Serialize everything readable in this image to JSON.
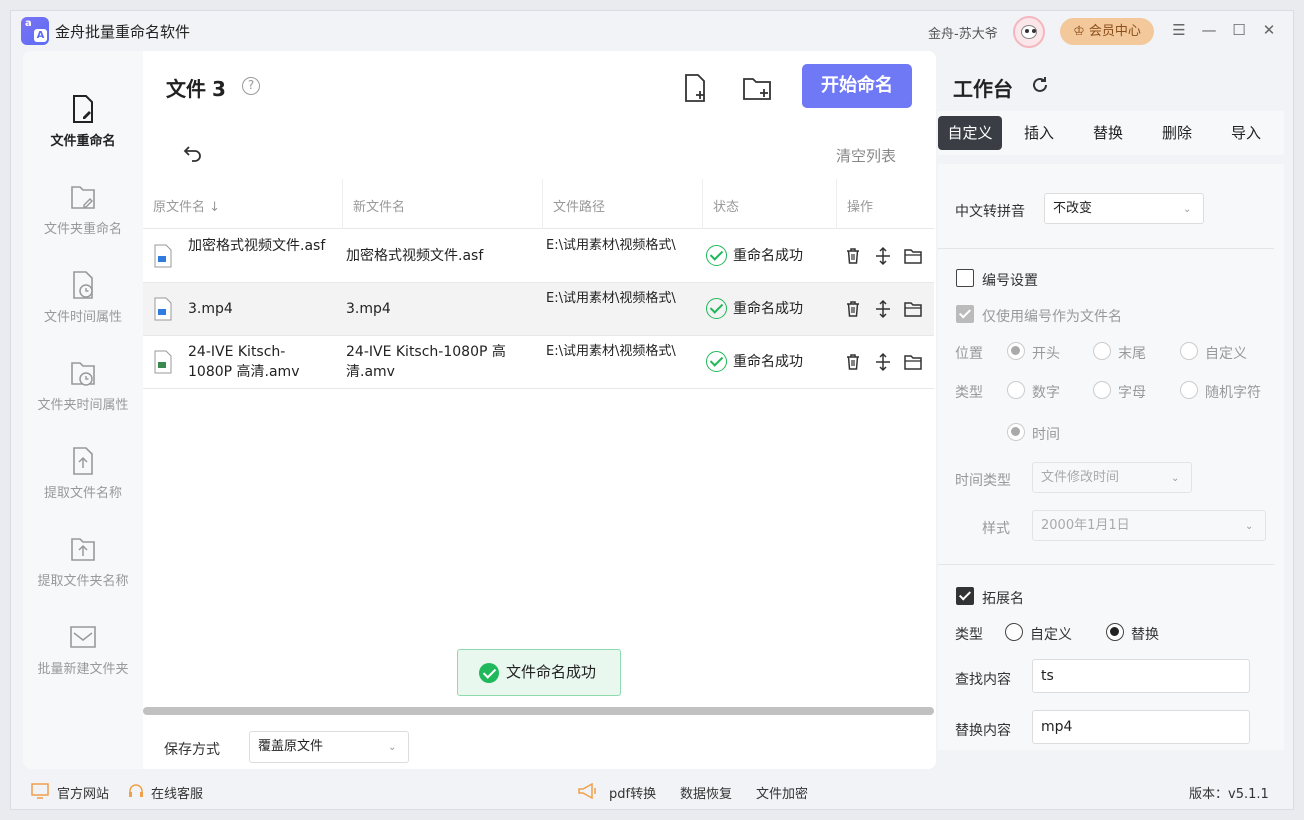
{
  "app": {
    "title": "金舟批量重命名软件",
    "user_name": "金舟-苏大爷",
    "vip_label": "会员中心"
  },
  "sidebar": {
    "items": [
      {
        "label": "文件重命名",
        "active": true
      },
      {
        "label": "文件夹重命名"
      },
      {
        "label": "文件时间属性"
      },
      {
        "label": "文件夹时间属性"
      },
      {
        "label": "提取文件名称"
      },
      {
        "label": "提取文件夹名称"
      },
      {
        "label": "批量新建文件夹"
      }
    ]
  },
  "main": {
    "title": "文件",
    "count": "3",
    "start_label": "开始命名",
    "clear_label": "清空列表",
    "columns": [
      "原文件名",
      "新文件名",
      "文件路径",
      "状态",
      "操作"
    ],
    "rows": [
      {
        "orig": "加密格式视频文件.asf",
        "new": "加密格式视频文件.asf",
        "path": "E:\\试用素材\\视频格式\\",
        "status": "重命名成功"
      },
      {
        "orig": "3.mp4",
        "new": "3.mp4",
        "path": "E:\\试用素材\\视频格式\\",
        "status": "重命名成功"
      },
      {
        "orig": "24-IVE Kitsch-1080P 高清.amv",
        "new": "24-IVE Kitsch-1080P 高清.amv",
        "path": "E:\\试用素材\\视频格式\\",
        "status": "重命名成功"
      }
    ],
    "toast": "文件命名成功",
    "save_label": "保存方式",
    "save_value": "覆盖原文件"
  },
  "workbench": {
    "title": "工作台",
    "tabs": [
      "自定义",
      "插入",
      "替换",
      "删除",
      "导入"
    ],
    "pinyin_label": "中文转拼音",
    "pinyin_value": "不改变",
    "numbering_label": "编号设置",
    "only_number_label": "仅使用编号作为文件名",
    "position_label": "位置",
    "position_options": [
      "开头",
      "末尾",
      "自定义"
    ],
    "type_label": "类型",
    "type_options": [
      "数字",
      "字母",
      "随机字符",
      "时间"
    ],
    "time_type_label": "时间类型",
    "time_type_value": "文件修改时间",
    "style_label": "样式",
    "style_value": "2000年1月1日",
    "ext_label": "拓展名",
    "ext_type_label": "类型",
    "ext_type_options": [
      "自定义",
      "替换"
    ],
    "find_label": "查找内容",
    "find_value": "ts",
    "replace_label": "替换内容",
    "replace_value": "mp4"
  },
  "footer": {
    "website": "官方网站",
    "service": "在线客服",
    "pdf": "pdf转换",
    "recovery": "数据恢复",
    "encrypt": "文件加密",
    "version": "版本：v5.1.1"
  },
  "colors": {
    "accent": "#6f78f5",
    "success": "#1fb85a",
    "tab_active": "#3a3d44"
  }
}
